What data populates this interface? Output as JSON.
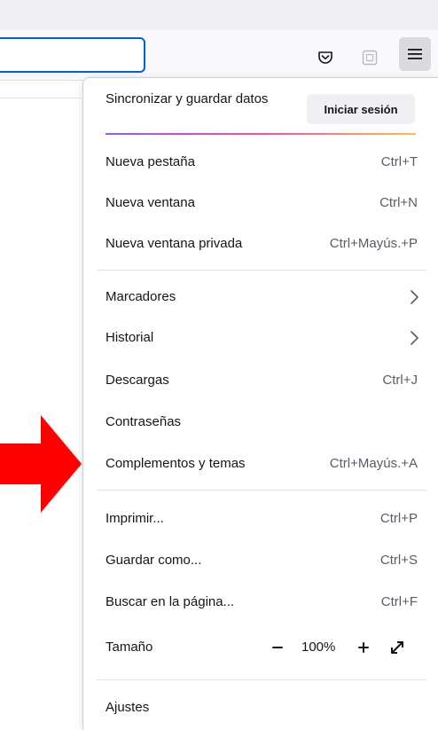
{
  "toolbar": {
    "icons": [
      "pocket-icon",
      "extension-icon",
      "hamburger-menu-icon"
    ]
  },
  "menu": {
    "sync": {
      "title": "Sincronizar y guardar datos",
      "signin_label": "Iniciar sesión"
    },
    "items": [
      {
        "label": "Nueva pestaña",
        "shortcut": "Ctrl+T"
      },
      {
        "label": "Nueva ventana",
        "shortcut": "Ctrl+N"
      },
      {
        "label": "Nueva ventana privada",
        "shortcut": "Ctrl+Mayús.+P"
      },
      {
        "label": "Marcadores",
        "icon": "chevron-right-icon"
      },
      {
        "label": "Historial",
        "icon": "chevron-right-icon"
      },
      {
        "label": "Descargas",
        "shortcut": "Ctrl+J"
      },
      {
        "label": "Contraseñas"
      },
      {
        "label": "Complementos y temas",
        "shortcut": "Ctrl+Mayús.+A"
      },
      {
        "label": "Imprimir...",
        "shortcut": "Ctrl+P"
      },
      {
        "label": "Guardar como...",
        "shortcut": "Ctrl+S"
      },
      {
        "label": "Buscar en la página...",
        "shortcut": "Ctrl+F"
      },
      {
        "label": "Ajustes"
      }
    ],
    "zoom": {
      "label": "Tamaño",
      "minus": "−",
      "value": "100%",
      "plus": "+"
    }
  },
  "annotation": {
    "arrow_color": "#ff0000"
  }
}
